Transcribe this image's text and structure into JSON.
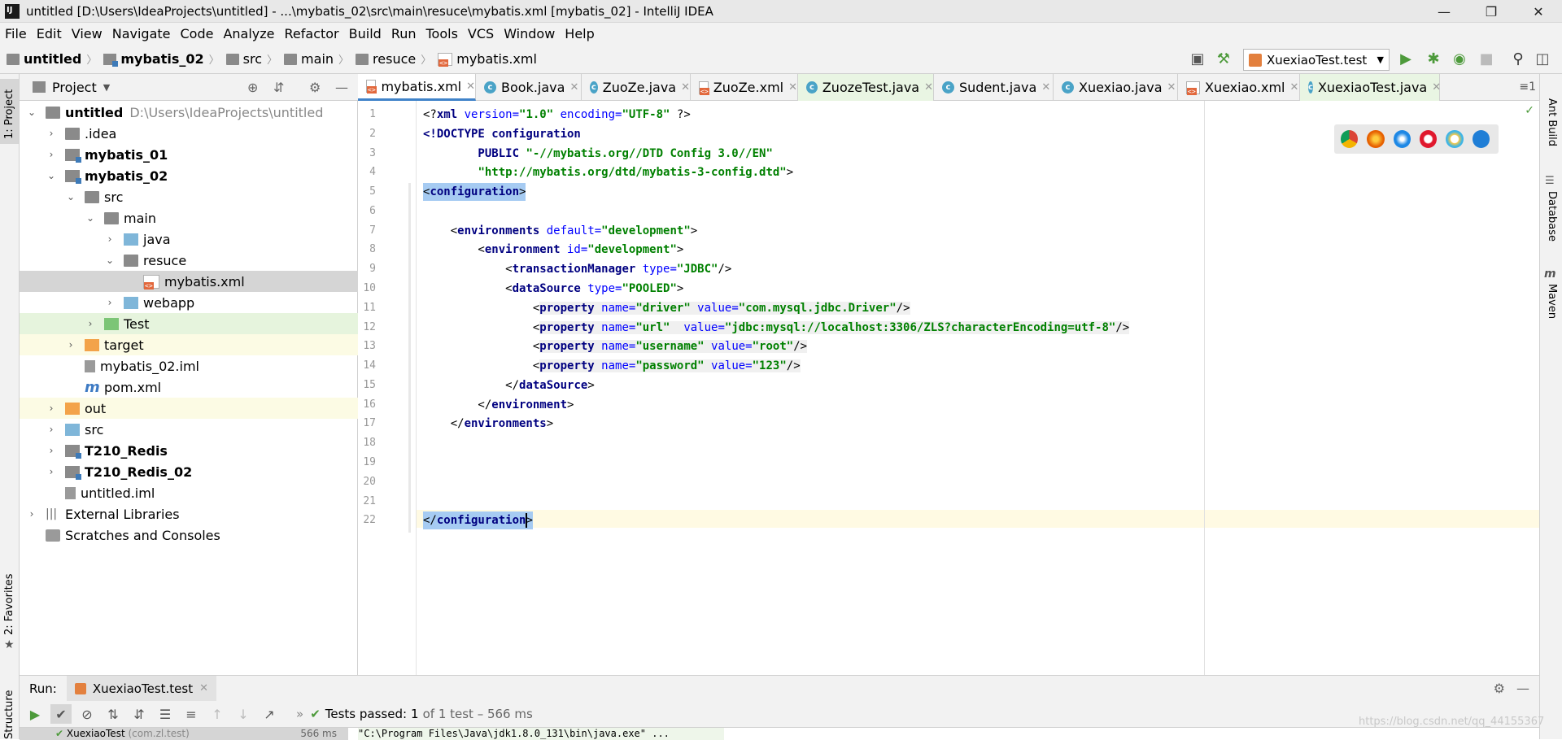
{
  "window": {
    "title": "untitled [D:\\Users\\IdeaProjects\\untitled] - ...\\mybatis_02\\src\\main\\resuce\\mybatis.xml [mybatis_02] - IntelliJ IDEA",
    "minimize": "—",
    "restore": "❐",
    "close": "✕"
  },
  "menu": [
    "File",
    "Edit",
    "View",
    "Navigate",
    "Code",
    "Analyze",
    "Refactor",
    "Build",
    "Run",
    "Tools",
    "VCS",
    "Window",
    "Help"
  ],
  "breadcrumb": [
    "untitled",
    "mybatis_02",
    "src",
    "main",
    "resuce",
    "mybatis.xml"
  ],
  "toolbar": {
    "run_config": "XuexiaoTest.test"
  },
  "left_stripe": {
    "project": "1: Project",
    "favorites": "2: Favorites",
    "structure": "Structure"
  },
  "right_stripe": {
    "ant": "Ant Build",
    "database": "Database",
    "maven": "Maven"
  },
  "project_panel": {
    "title": "Project",
    "tree": [
      {
        "label": "untitled",
        "path": "D:\\Users\\IdeaProjects\\untitled",
        "bold": true
      },
      {
        "label": ".idea"
      },
      {
        "label": "mybatis_01",
        "bold": true
      },
      {
        "label": "mybatis_02",
        "bold": true
      },
      {
        "label": "src"
      },
      {
        "label": "main"
      },
      {
        "label": "java"
      },
      {
        "label": "resuce"
      },
      {
        "label": "mybatis.xml"
      },
      {
        "label": "webapp"
      },
      {
        "label": "Test"
      },
      {
        "label": "target"
      },
      {
        "label": "mybatis_02.iml"
      },
      {
        "label": "pom.xml"
      },
      {
        "label": "out"
      },
      {
        "label": "src"
      },
      {
        "label": "T210_Redis",
        "bold": true
      },
      {
        "label": "T210_Redis_02",
        "bold": true
      },
      {
        "label": "untitled.iml"
      },
      {
        "label": "External Libraries"
      },
      {
        "label": "Scratches and Consoles"
      }
    ]
  },
  "tabs": [
    {
      "label": "mybatis.xml"
    },
    {
      "label": "Book.java"
    },
    {
      "label": "ZuoZe.java"
    },
    {
      "label": "ZuoZe.xml"
    },
    {
      "label": "ZuozeTest.java"
    },
    {
      "label": "Sudent.java"
    },
    {
      "label": "Xuexiao.java"
    },
    {
      "label": "Xuexiao.xml"
    },
    {
      "label": "XuexiaoTest.java"
    }
  ],
  "tabs_menu": "≡1",
  "editor": {
    "line_numbers": [
      "1",
      "2",
      "3",
      "4",
      "5",
      "6",
      "7",
      "8",
      "9",
      "10",
      "11",
      "12",
      "13",
      "14",
      "15",
      "16",
      "17",
      "18",
      "19",
      "20",
      "21",
      "22"
    ],
    "l1": {
      "a": "<?",
      "b": "xml",
      "c": " version=",
      "d": "\"1.0\"",
      "e": " encoding=",
      "f": "\"UTF-8\"",
      "g": " ?>"
    },
    "l2": {
      "a": "<!DOCTYPE configuration"
    },
    "l3": {
      "a": "        PUBLIC ",
      "b": "\"-//mybatis.org//DTD Config 3.0//EN\""
    },
    "l4": {
      "a": "        ",
      "b": "\"http://mybatis.org/dtd/mybatis-3-config.dtd\"",
      "c": ">"
    },
    "l5": {
      "a": "<",
      "b": "configuration",
      "c": ">"
    },
    "l7": {
      "a": "    <",
      "b": "environments",
      "c": " default=",
      "d": "\"development\"",
      "e": ">"
    },
    "l8": {
      "a": "        <",
      "b": "environment",
      "c": " id=",
      "d": "\"development\"",
      "e": ">"
    },
    "l9": {
      "a": "            <",
      "b": "transactionManager",
      "c": " type=",
      "d": "\"JDBC\"",
      "e": "/>"
    },
    "l10": {
      "a": "            <",
      "b": "dataSource",
      "c": " type=",
      "d": "\"POOLED\"",
      "e": ">"
    },
    "l11": {
      "a": "                <",
      "b": "property",
      "c": " name=",
      "d": "\"driver\"",
      "e": " value=",
      "f": "\"com.mysql.jdbc.Driver\"",
      "g": "/>"
    },
    "l12": {
      "a": "                <",
      "b": "property",
      "c": " name=",
      "d": "\"url\"",
      "e": "  value=",
      "f": "\"jdbc:mysql://localhost:3306/ZLS?characterEncoding=utf-8\"",
      "g": "/>"
    },
    "l13": {
      "a": "                <",
      "b": "property",
      "c": " name=",
      "d": "\"username\"",
      "e": " value=",
      "f": "\"root\"",
      "g": "/>"
    },
    "l14": {
      "a": "                <",
      "b": "property",
      "c": " name=",
      "d": "\"password\"",
      "e": " value=",
      "f": "\"123\"",
      "g": "/>"
    },
    "l15": {
      "a": "            </",
      "b": "dataSource",
      "c": ">"
    },
    "l16": {
      "a": "        </",
      "b": "environment",
      "c": ">"
    },
    "l17": {
      "a": "    </",
      "b": "environments",
      "c": ">"
    },
    "l22": {
      "a": "</",
      "b": "configuration",
      "c": ">"
    }
  },
  "run_panel": {
    "label": "Run:",
    "tab": "XuexiaoTest.test",
    "status_prefix": "Tests passed:",
    "status_count": "1",
    "status_suffix": "of 1 test – 566 ms",
    "bottom_left": "XuexiaoTest",
    "bottom_pkg": "(com.zl.test)",
    "bottom_ms": "566 ms",
    "bottom_path": "\"C:\\Program Files\\Java\\jdk1.8.0_131\\bin\\java.exe\" ..."
  },
  "watermark": "https://blog.csdn.net/qq_44155367",
  "colors": {
    "accent": "#4083c9",
    "selection": "#a6cbf2",
    "tag": "#000080",
    "attr": "#0000ff",
    "string": "#008000"
  }
}
